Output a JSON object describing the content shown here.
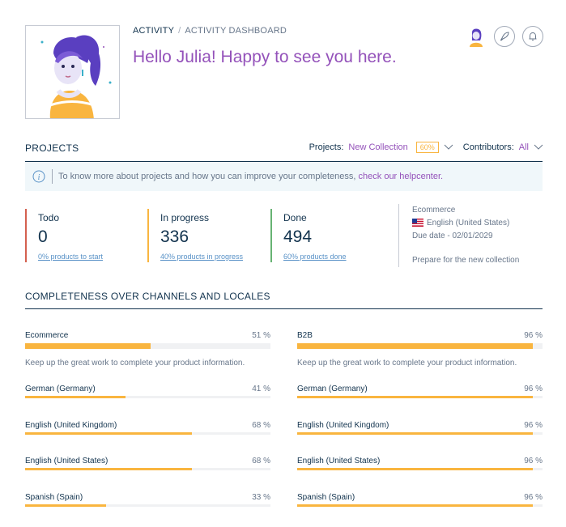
{
  "header": {
    "breadcrumb_root": "ACTIVITY",
    "breadcrumb_sep": "/",
    "breadcrumb_current": "ACTIVITY DASHBOARD",
    "greeting": "Hello Julia! Happy to see you here."
  },
  "projects": {
    "title": "PROJECTS",
    "projects_label": "Projects:",
    "projects_value": "New Collection",
    "projects_badge": "60%",
    "contributors_label": "Contributors:",
    "contributors_value": "All"
  },
  "helper": {
    "text": "To know more about projects and how you can improve your completeness,",
    "link": "check our helpcenter."
  },
  "stats": [
    {
      "label": "Todo",
      "value": "0",
      "sub": "0% products to start"
    },
    {
      "label": "In progress",
      "value": "336",
      "sub": "40% products in progress"
    },
    {
      "label": "Done",
      "value": "494",
      "sub": "60% products done"
    }
  ],
  "project_info": {
    "channel": "Ecommerce",
    "locale": "English (United States)",
    "due": "Due date - 02/01/2029",
    "description": "Prepare for the new collection"
  },
  "completeness": {
    "title": "COMPLETENESS OVER CHANNELS AND LOCALES",
    "keep_msg": "Keep up the great work to complete your product information.",
    "channels": [
      {
        "name": "Ecommerce",
        "pct": "51 %",
        "value": 0.51,
        "locales": [
          {
            "name": "German (Germany)",
            "pct": "41 %",
            "value": 0.41
          },
          {
            "name": "English (United Kingdom)",
            "pct": "68 %",
            "value": 0.68
          },
          {
            "name": "English (United States)",
            "pct": "68 %",
            "value": 0.68
          },
          {
            "name": "Spanish (Spain)",
            "pct": "33 %",
            "value": 0.33
          }
        ]
      },
      {
        "name": "B2B",
        "pct": "96 %",
        "value": 0.96,
        "locales": [
          {
            "name": "German (Germany)",
            "pct": "96 %",
            "value": 0.96
          },
          {
            "name": "English (United Kingdom)",
            "pct": "96 %",
            "value": 0.96
          },
          {
            "name": "English (United States)",
            "pct": "96 %",
            "value": 0.96
          },
          {
            "name": "Spanish (Spain)",
            "pct": "96 %",
            "value": 0.96
          }
        ]
      }
    ]
  },
  "icons": {
    "info": "info-icon",
    "rocket": "rocket-icon",
    "bell": "bell-icon",
    "chevron": "chevron-down-icon",
    "flag": "us-flag-icon"
  },
  "colors": {
    "accent": "#9452ba",
    "bar": "#f9b53f",
    "todo": "#d4604f",
    "in_progress": "#f9b53f",
    "done": "#67b373"
  }
}
